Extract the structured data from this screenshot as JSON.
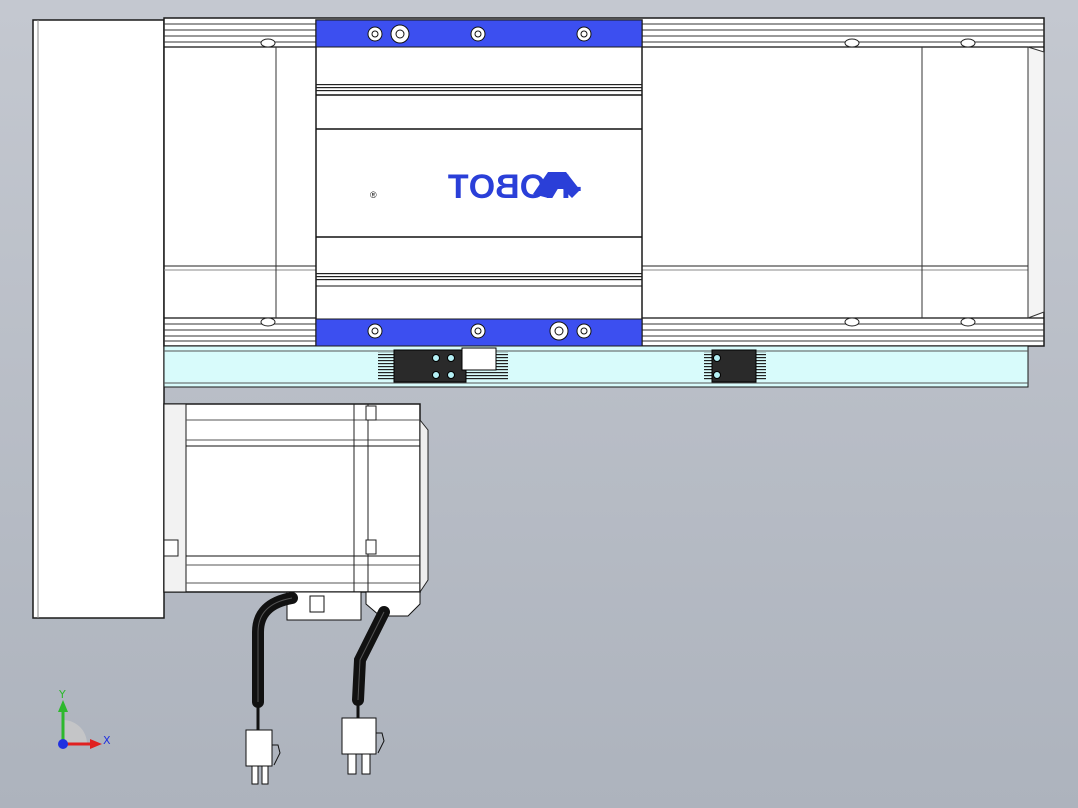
{
  "viewport": {
    "background_top": "#c4c8d0",
    "background_bottom": "#adb3bd"
  },
  "colors": {
    "body_white": "#ffffff",
    "outline": "#1a1a1a",
    "carriage_blue": "#3c4ff0",
    "logo_blue": "#2a3fd8",
    "rail_cyan": "#d8fbfb",
    "cable_black": "#111111",
    "triad_green": "#2db82d",
    "triad_red": "#e02020",
    "triad_blue": "#2030e0"
  },
  "carriage": {
    "logo_text": "-ROBOT",
    "logo_mirrored": true,
    "registered_mark": "®"
  },
  "triad": {
    "y_label": "Y",
    "x_label": "X"
  }
}
